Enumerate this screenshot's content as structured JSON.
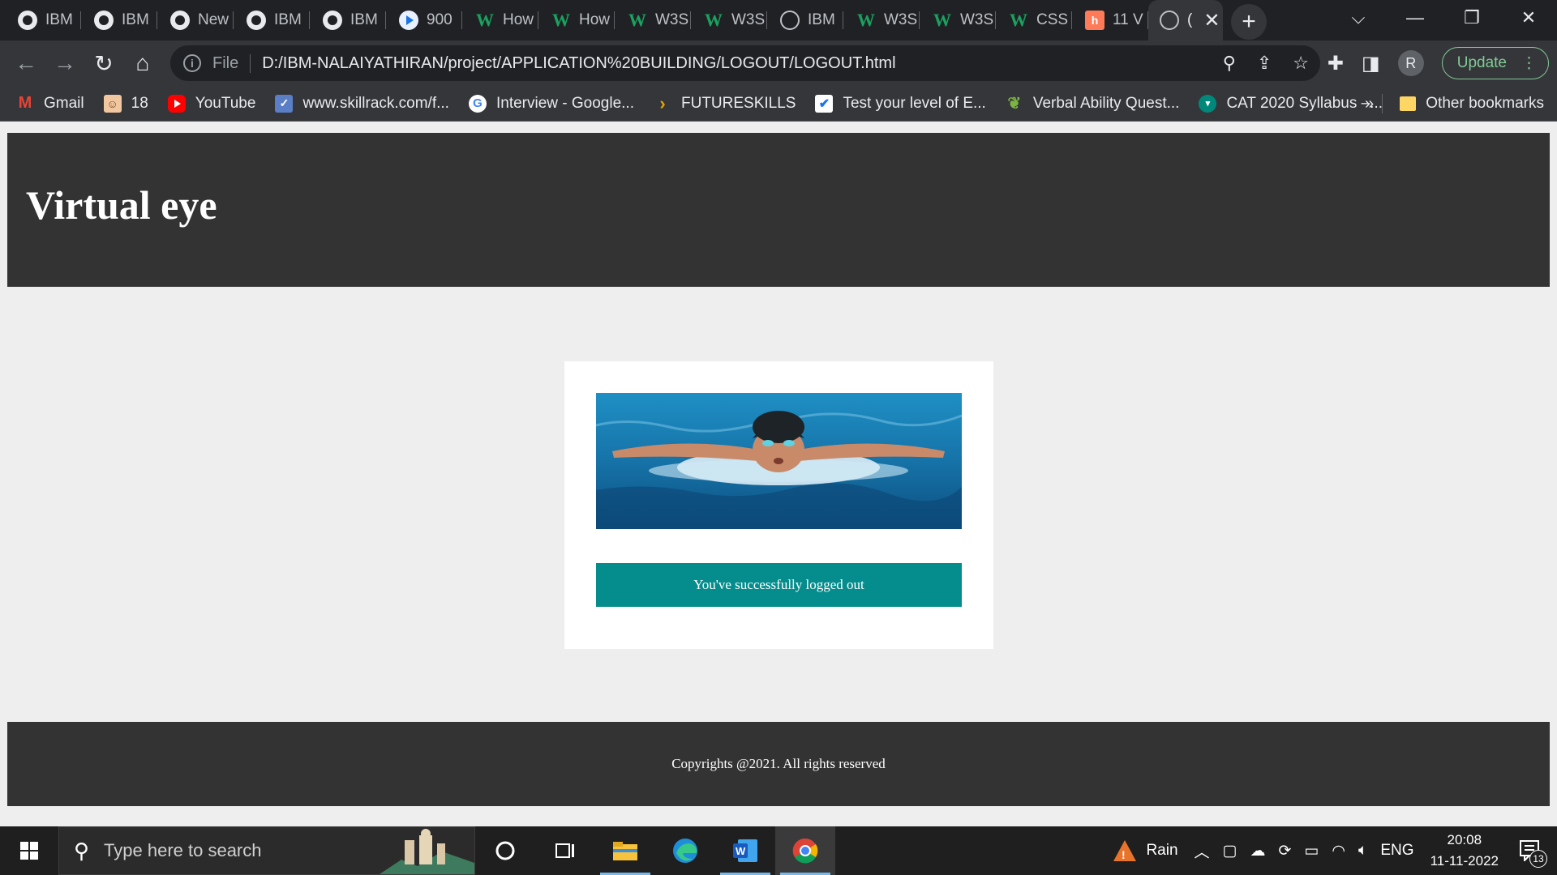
{
  "browser": {
    "tabs": [
      {
        "label": "IBM",
        "icon": "github-icon"
      },
      {
        "label": "IBM",
        "icon": "github-icon"
      },
      {
        "label": "New",
        "icon": "github-icon"
      },
      {
        "label": "IBM",
        "icon": "github-icon"
      },
      {
        "label": "IBM",
        "icon": "github-icon"
      },
      {
        "label": "900",
        "icon": "play-icon"
      },
      {
        "label": "How",
        "icon": "w3schools-icon"
      },
      {
        "label": "How",
        "icon": "w3schools-icon"
      },
      {
        "label": "W3S",
        "icon": "w3schools-icon"
      },
      {
        "label": "W3S",
        "icon": "w3schools-icon"
      },
      {
        "label": "IBM",
        "icon": "globe-icon"
      },
      {
        "label": "W3S",
        "icon": "w3schools-icon"
      },
      {
        "label": "W3S",
        "icon": "w3schools-icon"
      },
      {
        "label": "CSS",
        "icon": "w3schools-icon"
      },
      {
        "label": "11 V",
        "icon": "hubspot-icon"
      }
    ],
    "active_tab": {
      "label": "(",
      "icon": "globe-icon",
      "close": "✕"
    },
    "new_tab": "+",
    "window_controls": {
      "tab_search": "⌵",
      "minimize": "—",
      "restore": "❐",
      "close": "✕"
    },
    "toolbar": {
      "back": "←",
      "forward": "→",
      "reload": "↻",
      "home": "⌂",
      "site_info": "i",
      "scheme_label": "File",
      "url": "D:/IBM-NALAIYATHIRAN/project/APPLICATION%20BUILDING/LOGOUT/LOGOUT.html",
      "zoom": "⚲",
      "share": "⇪",
      "bookmark_star": "☆",
      "extensions": "✚",
      "side_panel": "◨",
      "profile_initial": "R",
      "update_label": "Update",
      "menu": "⋮"
    },
    "bookmarks": [
      {
        "label": "Gmail",
        "icon": "gmail-icon",
        "glyph": "M"
      },
      {
        "label": "18",
        "icon": "avatar-face-icon",
        "glyph": "☺"
      },
      {
        "label": "YouTube",
        "icon": "youtube-icon",
        "glyph": ""
      },
      {
        "label": "www.skillrack.com/f...",
        "icon": "skillrack-icon",
        "glyph": "✓"
      },
      {
        "label": "Interview - Google...",
        "icon": "google-icon",
        "glyph": "G"
      },
      {
        "label": "FUTURESKILLS",
        "icon": "futureskills-icon",
        "glyph": "›"
      },
      {
        "label": "Test your level of E...",
        "icon": "checkbox-icon",
        "glyph": "✔"
      },
      {
        "label": "Verbal Ability Quest...",
        "icon": "leaf-icon",
        "glyph": "❦"
      },
      {
        "label": "CAT 2020 Syllabus –...",
        "icon": "cat-icon",
        "glyph": "▾"
      }
    ],
    "bookmarks_more": "»",
    "other_bookmarks": "Other bookmarks"
  },
  "page": {
    "site_title": "Virtual eye",
    "logout_message": "You've successfully logged out",
    "footer_text": "Copyrights @2021. All rights reserved"
  },
  "taskbar": {
    "search_placeholder": "Type here to search",
    "weather_label": "Rain",
    "language": "ENG",
    "time": "20:08",
    "date": "11-11-2022",
    "notification_count": "13"
  }
}
